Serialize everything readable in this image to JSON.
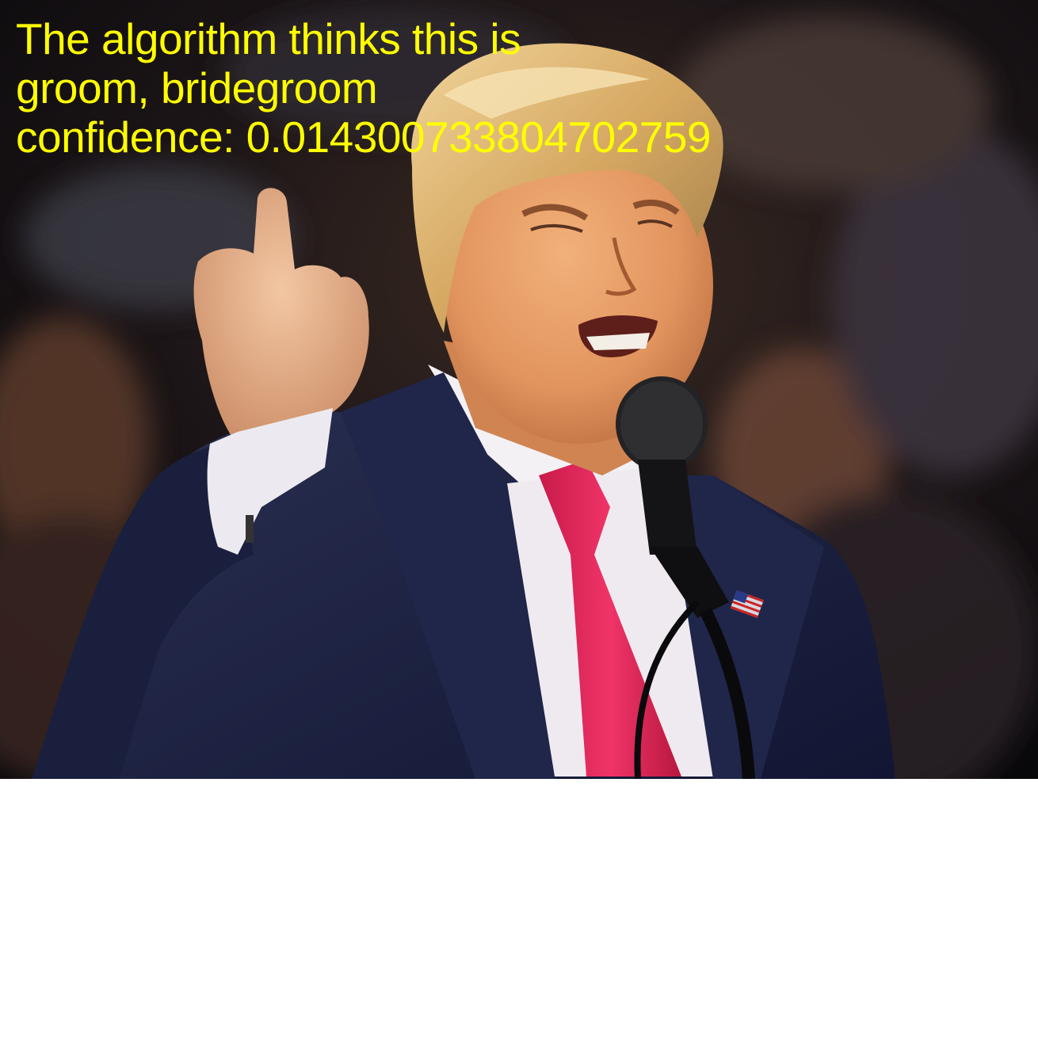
{
  "caption": {
    "line1": "The algorithm thinks this is",
    "line2": "groom, bridegroom",
    "line3": "confidence: 0.014300733804702759"
  },
  "colors": {
    "caption_text": "#ffff00",
    "background": "#ffffff",
    "suit": "#1b2140",
    "shirt": "#f3f1f4",
    "tie": "#e0245a",
    "hair": "#d9b06a",
    "skin": "#e59a63"
  }
}
